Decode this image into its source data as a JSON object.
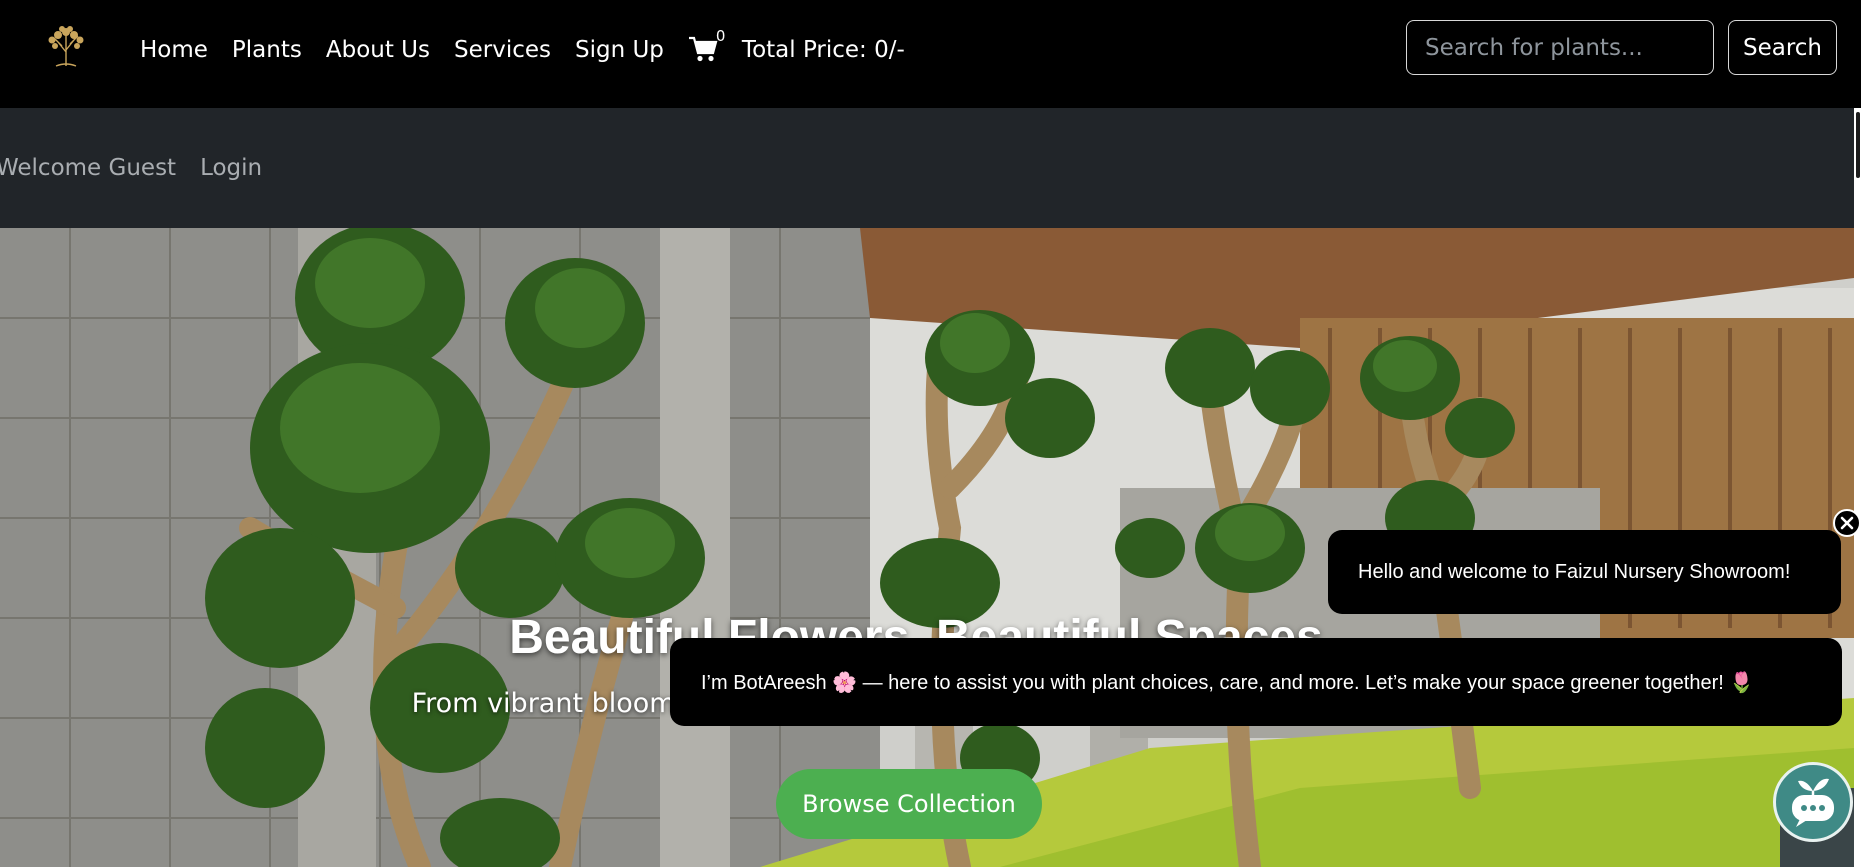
{
  "nav": {
    "logo_icon": "tree-logo-icon",
    "links": [
      "Home",
      "Plants",
      "About Us",
      "Services",
      "Sign Up"
    ],
    "cart_icon": "shopping-cart-icon",
    "cart_count": "0",
    "total_price": "Total Price: 0/-",
    "search_placeholder": "Search for plants...",
    "search_label": "Search"
  },
  "subnav": {
    "welcome": "Welcome Guest",
    "login": "Login"
  },
  "hero": {
    "title": "Beautiful Flowers, Beautiful Spaces",
    "subtitle": "From vibrant blooms to calm greens, find the perfect plants for your space",
    "cta": "Browse Collection"
  },
  "chat": {
    "greeting": "Hello and welcome to Faizul Nursery Showroom!",
    "intro": "I’m BotAreesh 🌸 — here to assist you with plant choices, care, and more. Let’s make your space greener together! 🌷",
    "close_icon": "close-icon",
    "launcher_icon": "chat-plant-icon"
  },
  "colors": {
    "navbar": "#000000",
    "subnav": "#212529",
    "cta": "#4caf50",
    "chat_launcher": "#3f8a86"
  }
}
